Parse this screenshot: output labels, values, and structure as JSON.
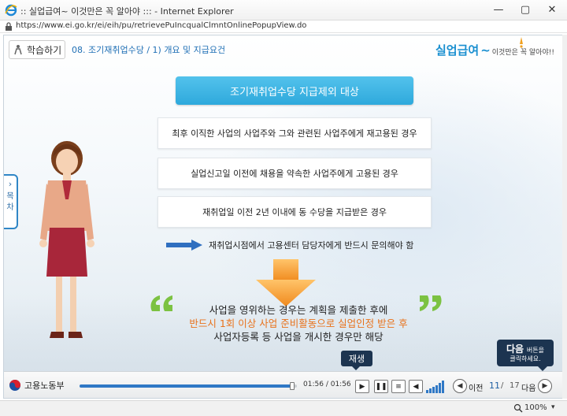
{
  "window": {
    "title": ":: 실업급여~ 이것만은 꼭 알아야 ::: - Internet Explorer",
    "url": "https://www.ei.go.kr/ei/eih/pu/retrievePuIncqualClmntOnlinePopupView.do",
    "minimize": "—",
    "maximize": "▢",
    "close": "✕"
  },
  "header": {
    "study_label": "학습하기",
    "section_title": "08. 조기재취업수당 / 1) 개요 및 지급요건",
    "brand_main": "실업급여",
    "brand_tilde": "~",
    "brand_sub": "이것만은 꼭 알아야!!"
  },
  "content": {
    "headline": "조기재취업수당 지급제외 대상",
    "items": [
      "최후 이직한 사업의 사업주와 그와 관련된 사업주에게 재고용된 경우",
      "실업신고일 이전에 채용을 약속한 사업주에게 고용된 경우",
      "재취업일 이전 2년 이내에 동 수당을 지급받은 경우"
    ],
    "notice": "재취업시점에서 고용센터 담당자에게 반드시 문의해야 함",
    "quote_line1": "사업을 영위하는 경우는 계획을 제출한 후에",
    "quote_line2": "반드시 1회 이상 사업 준비활동으로 실업인정 받은 후",
    "quote_line3": "사업자등록 등 사업을 개시한 경우만 해당"
  },
  "toc_tab": {
    "chevron": "›",
    "char1": "목",
    "char2": "차"
  },
  "bubbles": {
    "next_big": "다음",
    "next_small": "버튼을",
    "next_line2": "클릭하세요.",
    "play": "재생"
  },
  "controls": {
    "ministry": "고용노동부",
    "time_current": "01:56",
    "time_total": "01:56",
    "progress_fraction": 0.98,
    "play_icon": "▶",
    "pause_icon": "❚❚",
    "list_icon": "≡",
    "volume_icon": "◀",
    "prev_icon": "◀",
    "next_icon": "▶",
    "prev_label": "이전",
    "page_current": "11",
    "page_separator": "/",
    "page_total": "17",
    "next_label": "다음",
    "accent_color": "#2f78c6"
  },
  "statusbar": {
    "zoom": "100%",
    "zoom_dropdown": "▾"
  },
  "colors": {
    "headline_bg": "#2ea9dc",
    "highlight_text": "#e8721c",
    "bubble_bg": "#1c3450",
    "brand": "#1a8fd0"
  }
}
